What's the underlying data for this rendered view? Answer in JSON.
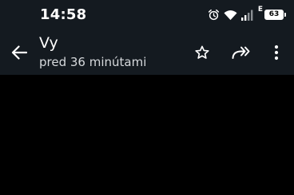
{
  "status_bar": {
    "time": "14:58",
    "network_type": "E",
    "battery_level": "63",
    "icons": [
      "alarm-icon",
      "wifi-icon",
      "signal-icon",
      "battery-icon"
    ]
  },
  "app_bar": {
    "title": "Vy",
    "subtitle": "pred 36 minútami",
    "icons": [
      "back-arrow-icon",
      "star-icon",
      "forward-icon",
      "more-vert-icon"
    ]
  },
  "colors": {
    "bar_background": "#141a20",
    "content_background": "#000000",
    "text_primary": "#ffffff",
    "text_secondary": "#d6d9dc"
  }
}
